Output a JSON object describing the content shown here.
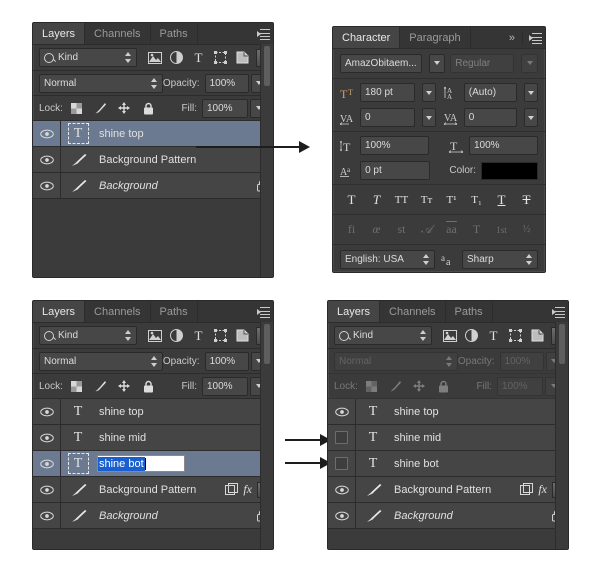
{
  "layers_panel_1": {
    "tabs": [
      "Layers",
      "Channels",
      "Paths"
    ],
    "active_tab": "Layers",
    "filter": {
      "kind_label": "Kind"
    },
    "blend_mode": "Normal",
    "opacity_label": "Opacity:",
    "opacity_value": "100%",
    "lock_label": "Lock:",
    "fill_label": "Fill:",
    "fill_value": "100%",
    "rows": [
      {
        "name": "shine top",
        "type": "text",
        "visible": true,
        "selected": true,
        "italic": false,
        "locked": false,
        "fx": false
      },
      {
        "name": "Background Pattern",
        "type": "brush",
        "visible": true,
        "selected": false,
        "italic": false,
        "locked": false,
        "fx": false
      },
      {
        "name": "Background",
        "type": "brush",
        "visible": true,
        "selected": false,
        "italic": true,
        "locked": true,
        "fx": false
      }
    ]
  },
  "character_panel": {
    "tabs": [
      "Character",
      "Paragraph"
    ],
    "active_tab": "Character",
    "font_family": "AmazObitaem...",
    "font_style": "Regular",
    "font_size": "180 pt",
    "leading": "(Auto)",
    "tracking": "0",
    "kerning": "0",
    "vertical_scale": "100%",
    "horizontal_scale": "100%",
    "baseline_shift": "0 pt",
    "color_label": "Color:",
    "color_value": "#000000",
    "style_buttons": [
      "T",
      "T",
      "TT",
      "Tт",
      "T¹",
      "T₁",
      "T",
      "T"
    ],
    "opentype_buttons": [
      "fi",
      "œ",
      "st",
      "𝒜",
      "aa",
      "T",
      "1st",
      "½"
    ],
    "language": "English: USA",
    "antialias": "Sharp"
  },
  "layers_panel_2": {
    "tabs": [
      "Layers",
      "Channels",
      "Paths"
    ],
    "active_tab": "Layers",
    "filter": {
      "kind_label": "Kind"
    },
    "blend_mode": "Normal",
    "opacity_label": "Opacity:",
    "opacity_value": "100%",
    "lock_label": "Lock:",
    "fill_label": "Fill:",
    "fill_value": "100%",
    "rows": [
      {
        "name": "shine top",
        "type": "text",
        "visible": true,
        "selected": false,
        "italic": false,
        "locked": false,
        "fx": false
      },
      {
        "name": "shine mid",
        "type": "text",
        "visible": true,
        "selected": false,
        "italic": false,
        "locked": false,
        "fx": false
      },
      {
        "name": "shine bot",
        "type": "text",
        "visible": true,
        "selected": true,
        "italic": false,
        "locked": false,
        "fx": false,
        "renaming": true,
        "rename_value": "shine bot"
      },
      {
        "name": "Background Pattern",
        "type": "brush",
        "visible": true,
        "selected": false,
        "italic": false,
        "locked": false,
        "fx": true
      },
      {
        "name": "Background",
        "type": "brush",
        "visible": true,
        "selected": false,
        "italic": true,
        "locked": true,
        "fx": false
      }
    ]
  },
  "layers_panel_3": {
    "tabs": [
      "Layers",
      "Channels",
      "Paths"
    ],
    "active_tab": "Layers",
    "filter": {
      "kind_label": "Kind"
    },
    "blend_mode": "Normal",
    "opacity_label": "Opacity:",
    "opacity_value": "100%",
    "lock_label": "Lock:",
    "fill_label": "Fill:",
    "fill_value": "100%",
    "disabled": true,
    "rows": [
      {
        "name": "shine top",
        "type": "text",
        "visible": true,
        "selected": false,
        "italic": false,
        "locked": false,
        "fx": false
      },
      {
        "name": "shine mid",
        "type": "text",
        "visible": false,
        "selected": false,
        "italic": false,
        "locked": false,
        "fx": false
      },
      {
        "name": "shine bot",
        "type": "text",
        "visible": false,
        "selected": false,
        "italic": false,
        "locked": false,
        "fx": false
      },
      {
        "name": "Background Pattern",
        "type": "brush",
        "visible": true,
        "selected": false,
        "italic": false,
        "locked": false,
        "fx": true
      },
      {
        "name": "Background",
        "type": "brush",
        "visible": true,
        "selected": false,
        "italic": true,
        "locked": true,
        "fx": false
      }
    ]
  },
  "annotations": {
    "arrow_top": "points from shine top layer row to Character panel",
    "arrow_mid": "points to shine mid visibility toggle",
    "arrow_bot": "points to shine bot visibility toggle"
  }
}
